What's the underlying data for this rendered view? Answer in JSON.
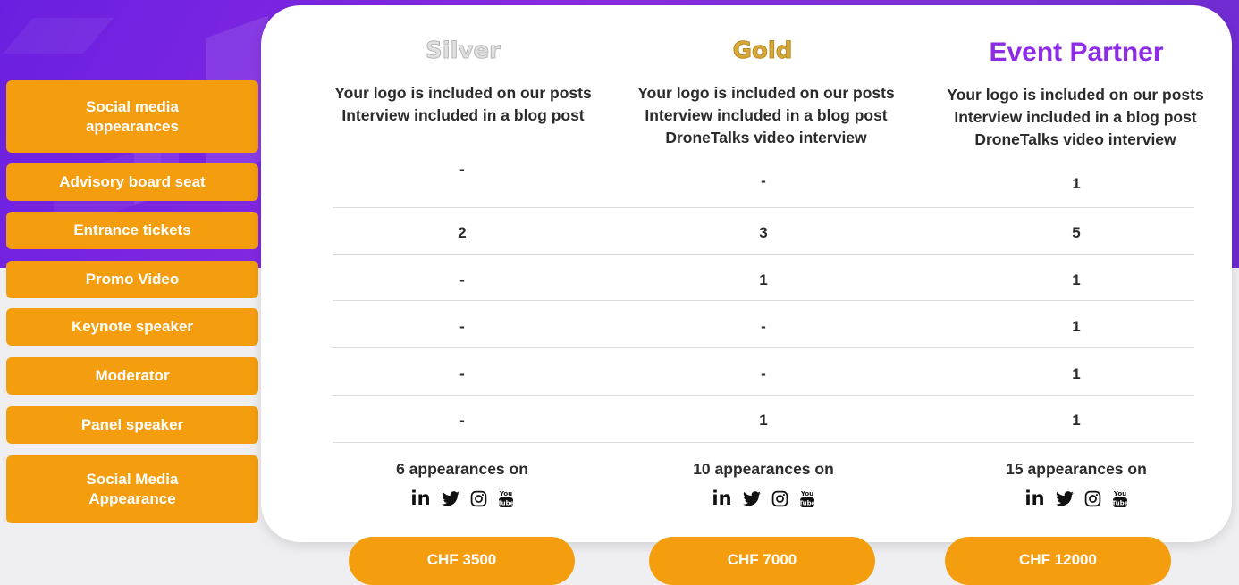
{
  "tiers": {
    "silver": {
      "name": "Silver",
      "social": [
        "Your logo is included on our posts",
        "Interview included in a blog post"
      ],
      "advisory": "-",
      "tickets": "2",
      "promo": "-",
      "keynote": "-",
      "moderator": "-",
      "panel": "-",
      "appearances": "6 appearances on",
      "price": "CHF 3500"
    },
    "gold": {
      "name": "Gold",
      "social": [
        "Your logo is included on our posts",
        "Interview included in a blog post",
        "DroneTalks video interview"
      ],
      "advisory": "-",
      "tickets": "3",
      "promo": "1",
      "keynote": "-",
      "moderator": "-",
      "panel": "1",
      "appearances": "10 appearances on",
      "price": "CHF 7000"
    },
    "partner": {
      "name": "Event Partner",
      "social": [
        "Your logo is included on our posts",
        "Interview included in a blog post",
        "DroneTalks video interview"
      ],
      "advisory": "1",
      "tickets": "5",
      "promo": "1",
      "keynote": "1",
      "moderator": "1",
      "panel": "1",
      "appearances": "15 appearances on",
      "price": "CHF 12000"
    }
  },
  "row_labels": {
    "social": "Social media appearances",
    "advisory": "Advisory board seat",
    "tickets": "Entrance tickets",
    "promo": "Promo Video",
    "keynote": "Keynote speaker",
    "moderator": "Moderator",
    "panel": "Panel speaker",
    "social_media": "Social Media Appearance"
  },
  "social_icons": [
    "linkedin-icon",
    "twitter-icon",
    "instagram-icon",
    "youtube-icon"
  ],
  "youtube_icon_text": {
    "top": "You",
    "bottom": "Tube"
  },
  "linkedin_text": "in",
  "colors": {
    "accent_orange": "#f49d0f",
    "purple": "#8d2be6",
    "gold": "#d7a83a",
    "silver": "#e0e0e0"
  }
}
